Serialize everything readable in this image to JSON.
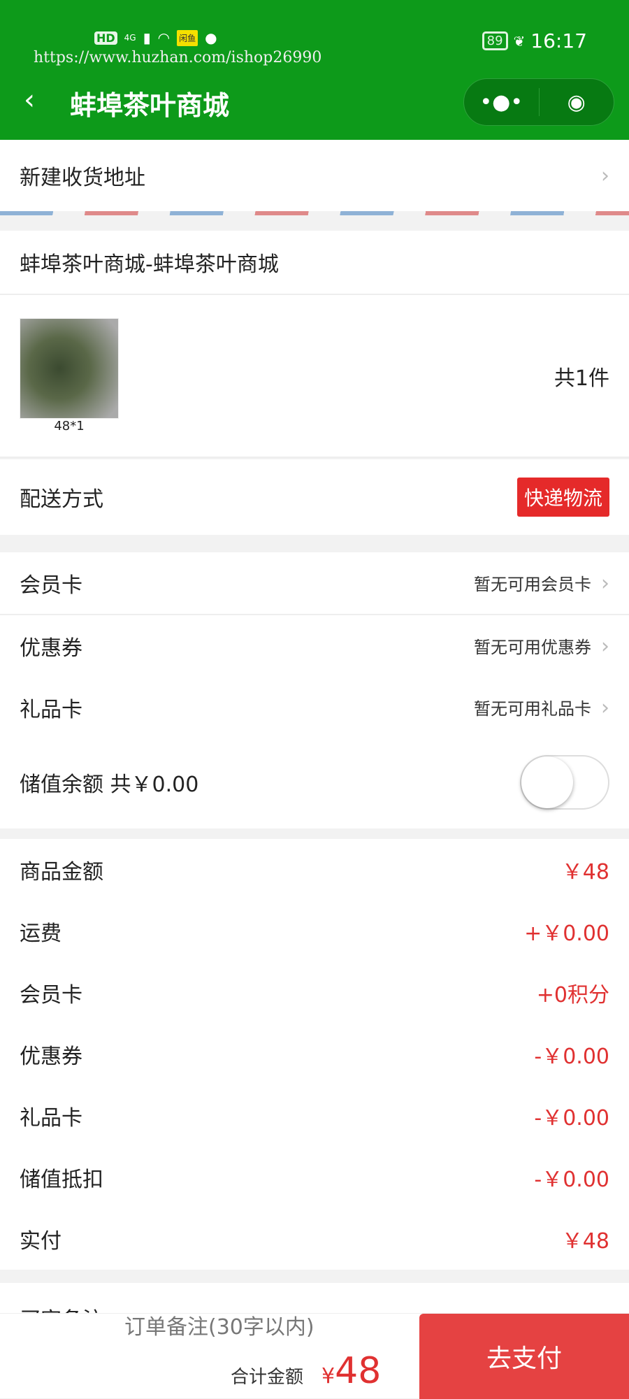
{
  "status": {
    "left_icons": [
      "HD",
      "4G",
      "signal-icon",
      "wifi-icon",
      "闲鱼",
      "wechat-icon"
    ],
    "battery": "89",
    "time": "16:17"
  },
  "watermark": "https://www.huzhan.com/ishop26990",
  "header": {
    "title": "蚌埠茶叶商城",
    "back_icon": "chevron-left-icon",
    "more_icon": "more-dots-icon",
    "close_icon": "target-icon",
    "color": "#0d9a1a"
  },
  "address": {
    "label": "新建收货地址"
  },
  "store": {
    "name": "蚌埠茶叶商城-蚌埠茶叶商城"
  },
  "product": {
    "price_qty": "48*1",
    "count": "共1件"
  },
  "delivery": {
    "label": "配送方式",
    "value": "快递物流"
  },
  "options": [
    {
      "label": "会员卡",
      "value": "暂无可用会员卡"
    },
    {
      "label": "优惠券",
      "value": "暂无可用优惠券"
    },
    {
      "label": "礼品卡",
      "value": "暂无可用礼品卡"
    }
  ],
  "balance": {
    "label": "储值余额 共￥0.00",
    "toggle_on": false
  },
  "summary": [
    {
      "label": "商品金额",
      "value": "￥48"
    },
    {
      "label": "运费",
      "value": "+￥0.00"
    },
    {
      "label": "会员卡",
      "value": "+0积分"
    },
    {
      "label": "优惠券",
      "value": "-￥0.00"
    },
    {
      "label": "礼品卡",
      "value": "-￥0.00"
    },
    {
      "label": "储值抵扣",
      "value": "-￥0.00"
    },
    {
      "label": "实付",
      "value": "￥48"
    }
  ],
  "remark": {
    "label": "买家备注",
    "placeholder": "订单备注(30字以内)"
  },
  "footer": {
    "total_label": "合计金额",
    "currency": "¥",
    "total": "48",
    "pay_label": "去支付"
  }
}
